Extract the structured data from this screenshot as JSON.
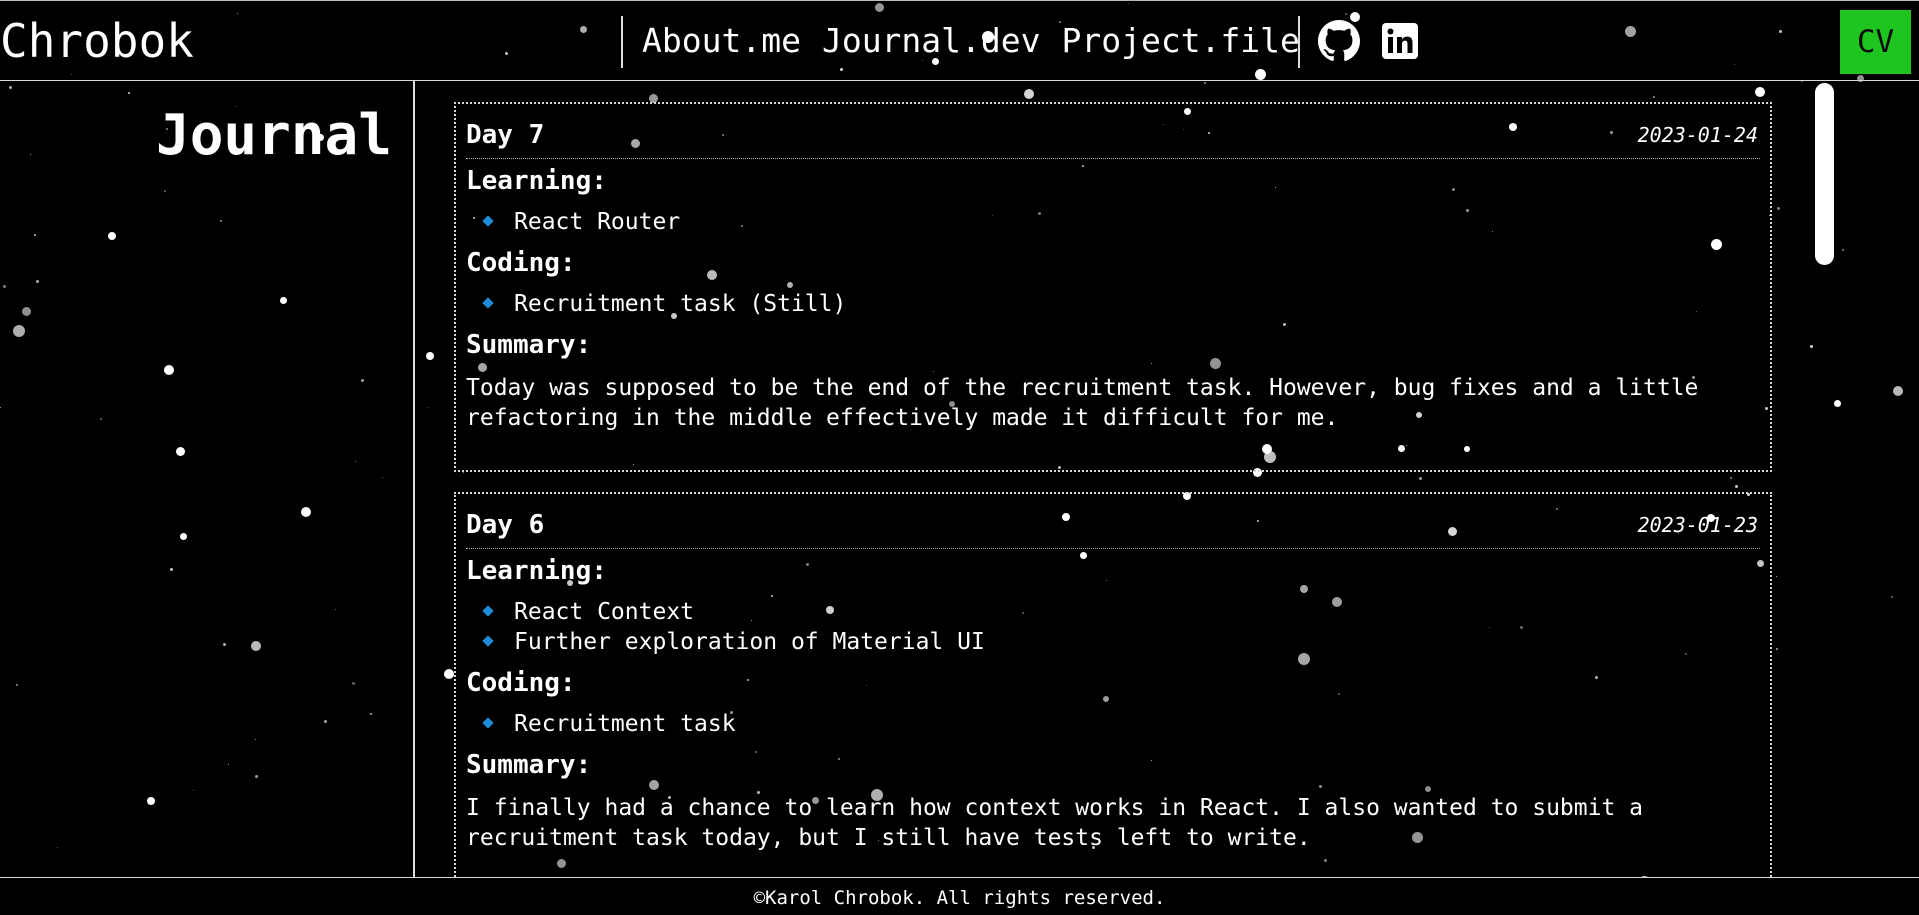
{
  "header": {
    "logo": "Chrobok",
    "nav": [
      "About.me",
      "Journal.dev",
      "Project.file"
    ],
    "social_icons": [
      "github-icon",
      "linkedin-icon"
    ],
    "cv_label": "CV",
    "cv_color": "#1fc51f"
  },
  "sidebar": {
    "title": "Journal"
  },
  "entries": [
    {
      "day": "Day 7",
      "date": "2023-01-24",
      "learning_title": "Learning:",
      "learning": [
        "React Router"
      ],
      "coding_title": "Coding:",
      "coding": [
        "Recruitment task (Still)"
      ],
      "summary_title": "Summary:",
      "summary": "Today was supposed to be the end of the recruitment task. However, bug fixes and a little\nrefactoring in the middle effectively made it difficult for me."
    },
    {
      "day": "Day 6",
      "date": "2023-01-23",
      "learning_title": "Learning:",
      "learning": [
        "React Context",
        "Further exploration of Material UI"
      ],
      "coding_title": "Coding:",
      "coding": [
        "Recruitment task"
      ],
      "summary_title": "Summary:",
      "summary": "I finally had a chance to learn how context works in React. I also wanted to submit a\nrecruitment task today, but I still have tests left to write."
    }
  ],
  "footer": {
    "copyright": "©Karol Chrobok. All rights reserved."
  },
  "colors": {
    "bullet": "#1f8ad8",
    "background": "#000000",
    "text": "#ffffff"
  }
}
